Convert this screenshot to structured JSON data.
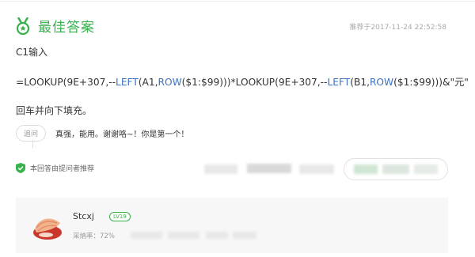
{
  "header": {
    "title": "最佳答案",
    "timestamp": "推荐于2017-11-24 22:52:58"
  },
  "answer": {
    "line1": "C1输入",
    "formula_parts": {
      "p1": "=LOOKUP(9E+307,--",
      "fn1": "LEFT",
      "p2": "(A1,",
      "fn2": "ROW",
      "p3": "($1:$99)))*LOOKUP(9E+307,--",
      "fn3": "LEFT",
      "p4": "(B1,",
      "fn4": "ROW",
      "p5": "($1:$99)))&\"元\""
    },
    "instruction": "回车并向下填充。"
  },
  "followup": {
    "badge": "追问",
    "text": "真强，能用。谢谢咯~！你是第一个！"
  },
  "recommend": {
    "text": "本回答由提问者推荐"
  },
  "user": {
    "name": "Stcxj",
    "level": "LV19",
    "adopt_rate": "采纳率：72%"
  },
  "colors": {
    "accent_green": "#37b24d",
    "function_blue": "#3a72c4"
  },
  "icons": {
    "medal": "medal-icon",
    "shield": "shield-check-icon"
  }
}
